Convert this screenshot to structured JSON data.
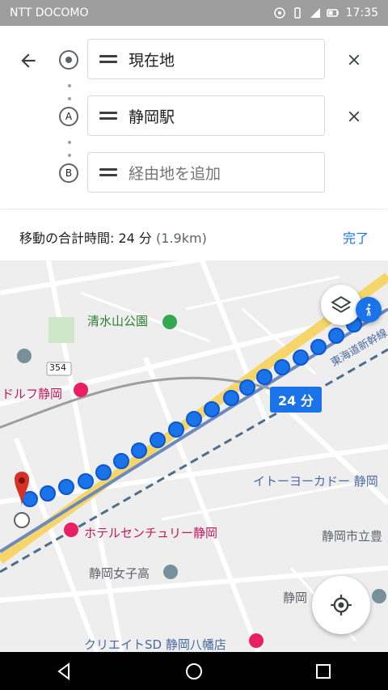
{
  "status_bar": {
    "carrier": "NTT DOCOMO",
    "time": "17:35"
  },
  "directions": {
    "back_label": "",
    "origin": {
      "value": "現在地"
    },
    "destination_a": {
      "value": "静岡駅"
    },
    "waypoint_b": {
      "placeholder": "経由地を追加",
      "marker": "B"
    },
    "a_marker": "A"
  },
  "summary": {
    "time_label": "移動の合計時間: 24 分",
    "distance": "(1.9km)",
    "done_label": "完了"
  },
  "map": {
    "labels": {
      "park": "清水山公園",
      "hotel1": "ドルフ静岡",
      "hotel2": "ホテルセンチュリー静岡",
      "store": "イトーヨーカドー 静岡",
      "school": "静岡女子高",
      "rail": "東海道新幹線",
      "city_office": "静岡市立豊",
      "road_num": "354",
      "shizuoka": "静岡",
      "pharmacy": "クリエイトSD 静岡八幡店"
    },
    "duration_badge": "24 分"
  },
  "colors": {
    "accent": "#1a73e8",
    "route": "#1a73e8",
    "pin": "#d93025"
  }
}
